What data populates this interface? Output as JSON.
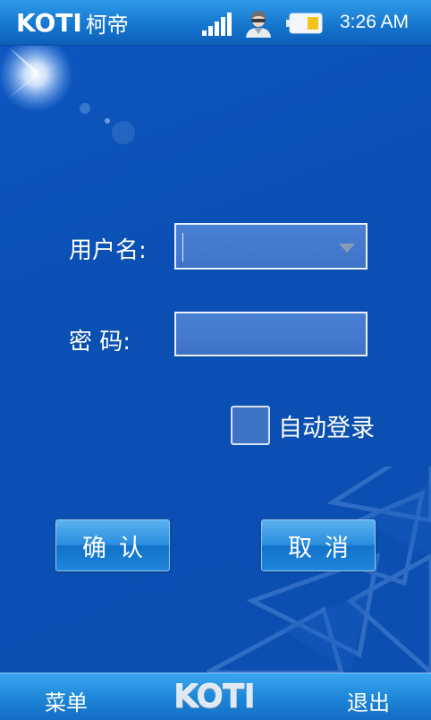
{
  "statusbar": {
    "brand_en": "KOTI",
    "brand_cn": "柯帝",
    "time": "3:26 AM",
    "icons": [
      "signal-icon",
      "user-avatar-icon",
      "battery-icon"
    ]
  },
  "form": {
    "username_label": "用户名:",
    "username_value": "",
    "password_label": "密 码:",
    "password_value": "",
    "auto_login_label": "自动登录",
    "auto_login_checked": false,
    "confirm_label": "确认",
    "cancel_label": "取消"
  },
  "bottombar": {
    "menu_label": "菜单",
    "logo_text": "KOTI",
    "exit_label": "退出"
  },
  "colors": {
    "background": "#0b4fb3",
    "bar": "#1f88da",
    "field": "#3f73c6"
  }
}
